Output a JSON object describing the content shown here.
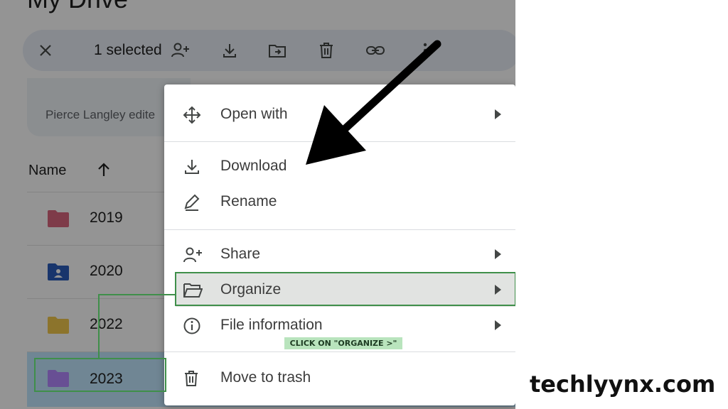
{
  "drive": {
    "page_title": "My Drive",
    "selection_bar": {
      "count_label": "1 selected",
      "actions": [
        "close-icon",
        "share-icon",
        "download-icon",
        "move-icon",
        "trash-icon",
        "link-icon",
        "more-icon"
      ]
    },
    "suggestion_text": "Pierce Langley edite",
    "column_header": "Name",
    "rows": [
      {
        "name": "2019",
        "folder_color": "#d9677f"
      },
      {
        "name": "2020",
        "folder_color": "#2a5cba"
      },
      {
        "name": "2022",
        "folder_color": "#f2c94c"
      },
      {
        "name": "2023",
        "folder_color": "#b388ff"
      }
    ]
  },
  "menu": {
    "items": [
      {
        "label": "Open with",
        "icon": "move-arrows-icon",
        "submenu": true
      },
      {
        "label": "Download",
        "icon": "download-icon",
        "submenu": false
      },
      {
        "label": "Rename",
        "icon": "pencil-icon",
        "submenu": false
      },
      {
        "label": "Share",
        "icon": "share-person-icon",
        "submenu": true
      },
      {
        "label": "Organize",
        "icon": "folder-open-icon",
        "submenu": true
      },
      {
        "label": "File information",
        "icon": "info-icon",
        "submenu": true
      },
      {
        "label": "Move to trash",
        "icon": "trash-icon",
        "submenu": false
      }
    ]
  },
  "annotation": {
    "caption": "CLICK ON \"ORGANIZE >\"",
    "highlight_color": "#3f8f4a"
  },
  "brand": "techlyynx.com"
}
